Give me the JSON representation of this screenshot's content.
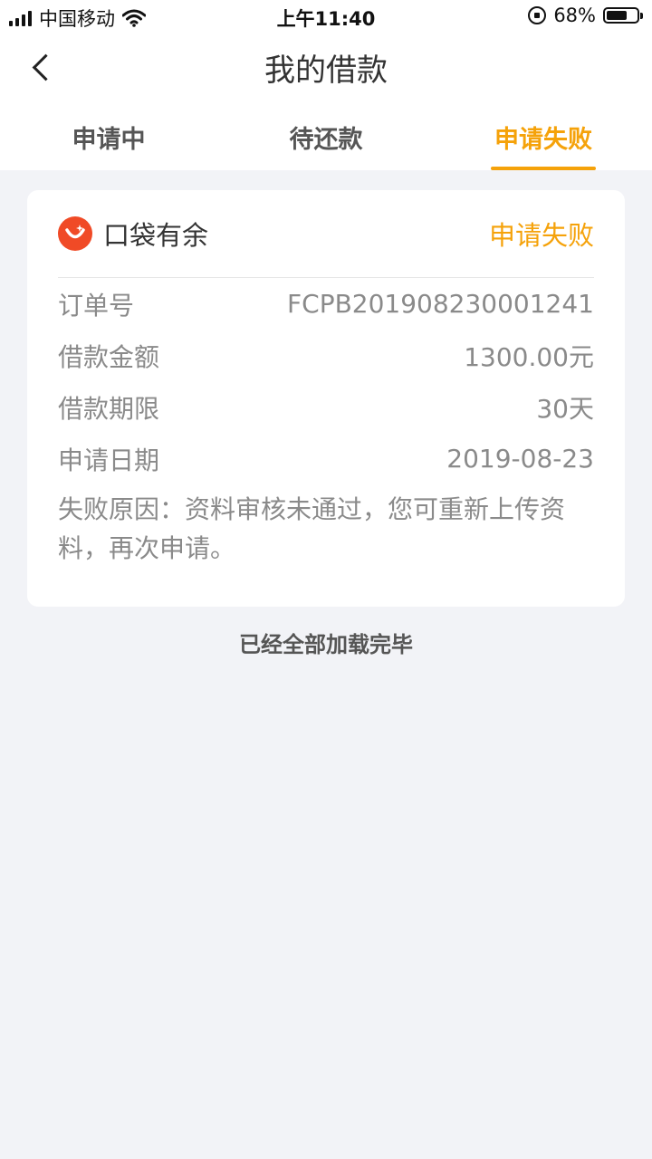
{
  "status_bar": {
    "carrier": "中国移动",
    "time": "上午11:40",
    "battery_percent": "68%",
    "battery_level": 0.68
  },
  "nav": {
    "title": "我的借款"
  },
  "tabs": [
    {
      "label": "申请中",
      "active": false
    },
    {
      "label": "待还款",
      "active": false
    },
    {
      "label": "申请失败",
      "active": true
    }
  ],
  "card": {
    "brand": "口袋有余",
    "status": "申请失败",
    "rows": [
      {
        "label": "订单号",
        "value": "FCPB201908230001241"
      },
      {
        "label": "借款金额",
        "value": "1300.00元"
      },
      {
        "label": "借款期限",
        "value": "30天"
      },
      {
        "label": "申请日期",
        "value": "2019-08-23"
      }
    ],
    "reason": "失败原因：资料审核未通过，您可重新上传资料，再次申请。"
  },
  "footer_note": "已经全部加载完毕",
  "colors": {
    "accent": "#f5a20a",
    "brand_logo": "#f04a26",
    "background": "#f2f3f7"
  }
}
